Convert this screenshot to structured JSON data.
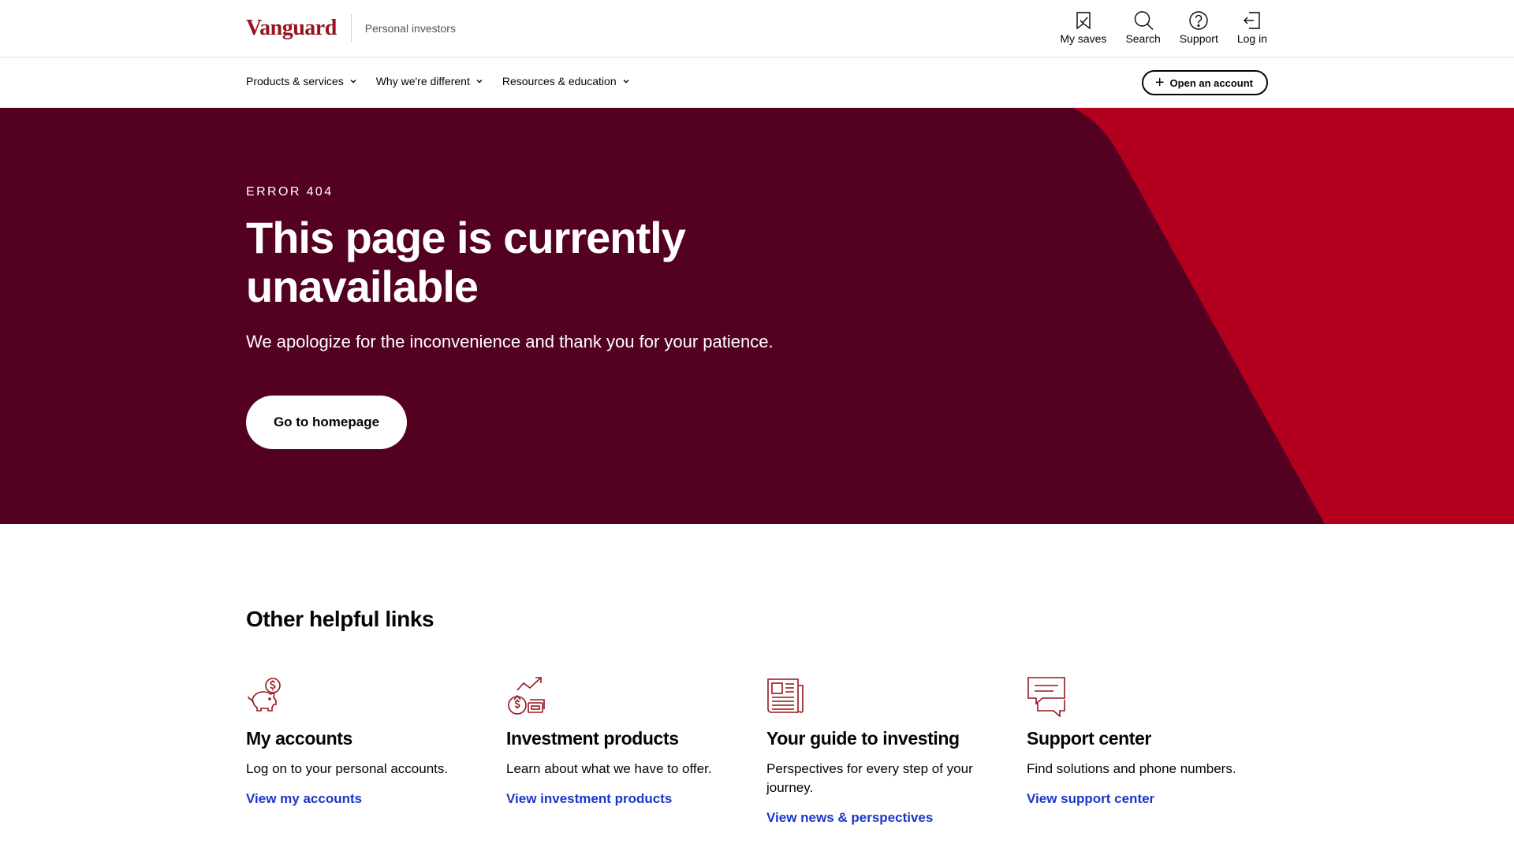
{
  "header": {
    "logo": "Vanguard",
    "section": "Personal investors",
    "utility": [
      {
        "label": "My saves",
        "icon": "bookmark-icon"
      },
      {
        "label": "Search",
        "icon": "search-icon"
      },
      {
        "label": "Support",
        "icon": "help-icon"
      },
      {
        "label": "Log in",
        "icon": "login-icon"
      }
    ]
  },
  "nav": {
    "items": [
      {
        "label": "Products & services"
      },
      {
        "label": "Why we're different"
      },
      {
        "label": "Resources & education"
      }
    ],
    "cta": "Open an account"
  },
  "hero": {
    "eyebrow": "ERROR 404",
    "title": "This page is currently unavailable",
    "text": "We apologize for the inconvenience and thank you for your patience.",
    "button": "Go to homepage"
  },
  "links": {
    "heading": "Other helpful links",
    "cards": [
      {
        "icon": "piggy-bank-icon",
        "title": "My accounts",
        "text": "Log on to your personal accounts.",
        "link": "View my accounts"
      },
      {
        "icon": "money-growth-icon",
        "title": "Investment products",
        "text": "Learn about what we have to offer.",
        "link": "View investment products"
      },
      {
        "icon": "newspaper-icon",
        "title": "Your guide to investing",
        "text": "Perspectives for every step of your journey.",
        "link": "View news & perspectives"
      },
      {
        "icon": "chat-bubbles-icon",
        "title": "Support center",
        "text": "Find solutions and phone numbers.",
        "link": "View support center"
      }
    ]
  },
  "colors": {
    "brand": "#96151d",
    "hero_bg": "#530021",
    "hero_accent": "#b3001e",
    "link": "#1a36c8"
  }
}
